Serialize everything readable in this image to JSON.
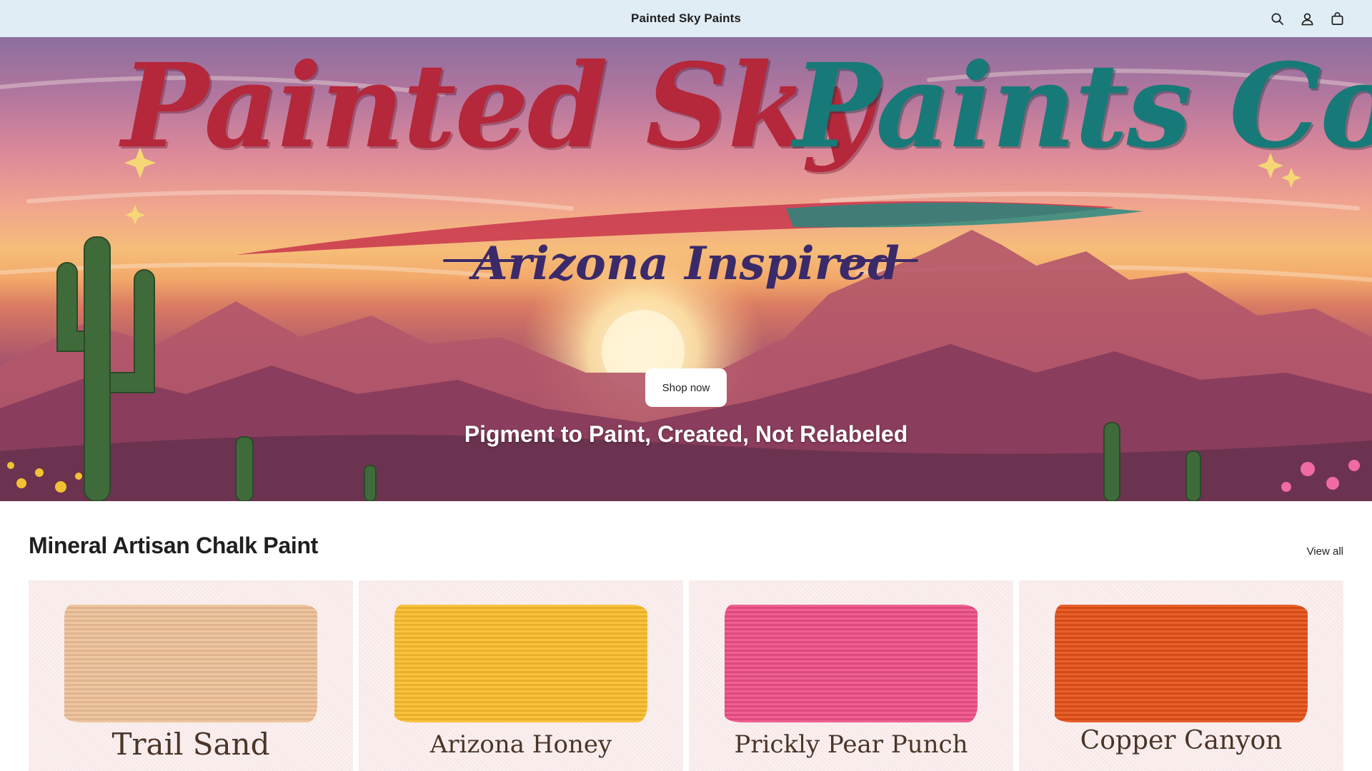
{
  "header": {
    "brand": "Painted Sky Paints",
    "icons": [
      "search-icon",
      "account-icon",
      "cart-icon"
    ],
    "background": "#e1edf5"
  },
  "hero": {
    "logo_part1": "Painted Sky",
    "logo_part2": "Paints Co.",
    "logo_sub": "Arizona Inspired",
    "cta_label": "Shop now",
    "tagline": "Pigment to Paint, Created, Not Relabeled",
    "colors": {
      "logo_red": "#b5273a",
      "logo_teal": "#177a78",
      "sub_purple": "#3b2a6a"
    }
  },
  "collection": {
    "title": "Mineral Artisan Chalk Paint",
    "view_all_label": "View all",
    "products": [
      {
        "name": "Trail Sand",
        "swatch_color": "#edbf98"
      },
      {
        "name": "Arizona Honey",
        "swatch_color": "#f7bc2b"
      },
      {
        "name": "Prickly Pear Punch",
        "swatch_color": "#ec4f86"
      },
      {
        "name": "Copper Canyon",
        "swatch_color": "#e34f15"
      }
    ]
  }
}
